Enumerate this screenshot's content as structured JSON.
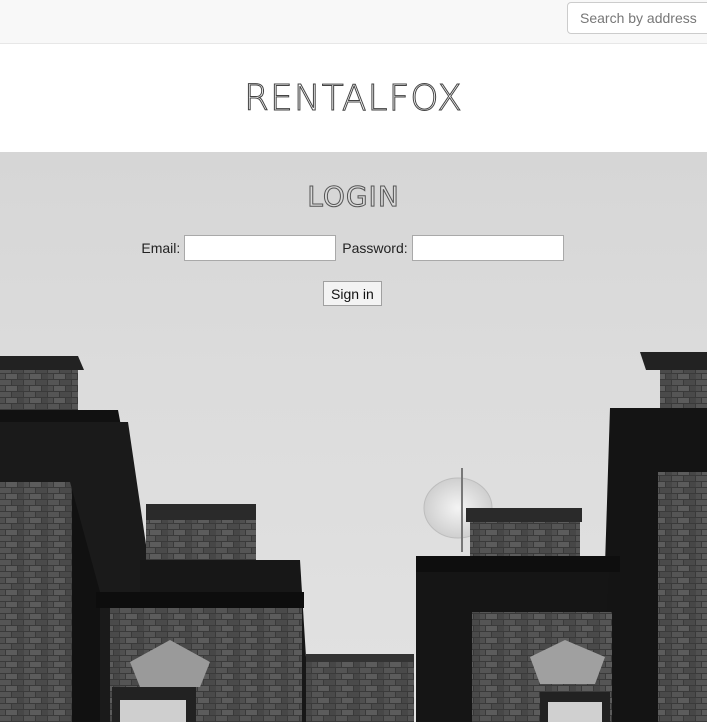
{
  "nav": {
    "search": {
      "placeholder": "Search by address",
      "value": ""
    }
  },
  "brand": {
    "logo_text": "RENTALFOX"
  },
  "login": {
    "title": "LOGIN",
    "email_label": "Email:",
    "email_value": "",
    "password_label": "Password:",
    "password_value": "",
    "submit_label": "Sign in"
  }
}
